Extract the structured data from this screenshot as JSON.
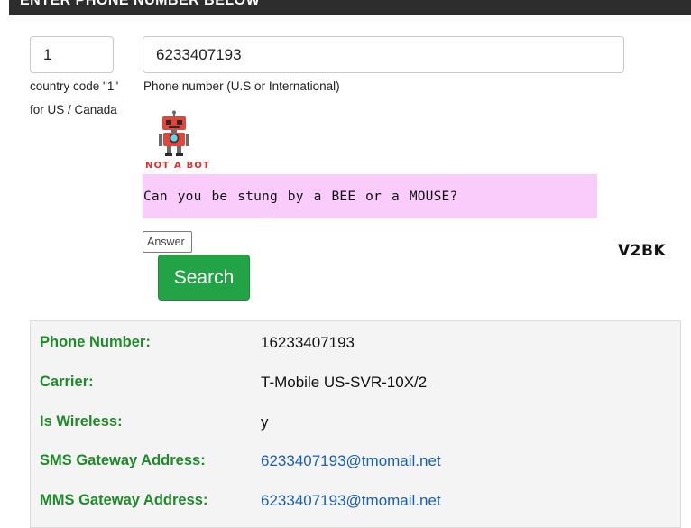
{
  "header": {
    "title": "ENTER PHONE NUMBER BELOW"
  },
  "form": {
    "country_code_value": "1",
    "country_code_help": "country code \"1\" for US / Canada",
    "phone_value": "6233407193",
    "phone_help": "Phone number (U.S or International)"
  },
  "captcha": {
    "badge_text": "NOT A BOT",
    "question": "Can you be stung by a BEE or a MOUSE?",
    "answer_placeholder": "Answer",
    "colors": {
      "question_bg": "#f9ccfc",
      "badge": "#d8322b"
    },
    "robot_icon": "robot-icon"
  },
  "search_button": {
    "label": "Search",
    "color": "#22a345"
  },
  "watermark": "V2BK",
  "results": {
    "label_color": "#1e8a2a",
    "link_color": "#1a5fb4",
    "rows": [
      {
        "label": "Phone Number:",
        "value": "16233407193"
      },
      {
        "label": "Carrier:",
        "value": "T-Mobile US-SVR-10X/2"
      },
      {
        "label": "Is Wireless:",
        "value": "y"
      },
      {
        "label": "SMS Gateway Address:",
        "value": "6233407193@tmomail.net"
      },
      {
        "label": "MMS Gateway Address:",
        "value": "6233407193@tmomail.net"
      }
    ]
  }
}
